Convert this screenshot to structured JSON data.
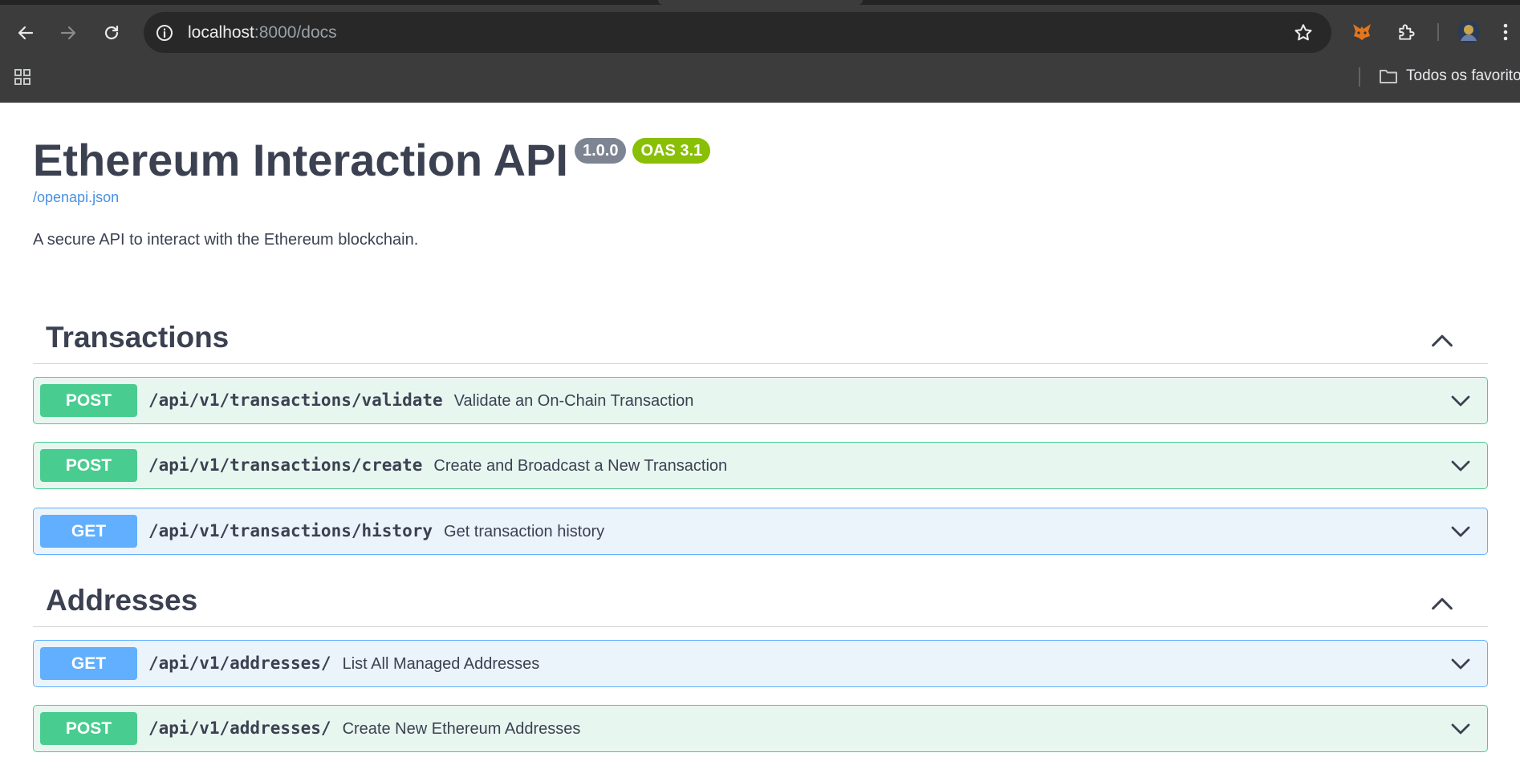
{
  "browser": {
    "url_host": "localhost",
    "url_path": ":8000/docs",
    "bookmarks_folder": "Todos os favoritos"
  },
  "api": {
    "title": "Ethereum Interaction API",
    "version": "1.0.0",
    "oas": "OAS 3.1",
    "spec_link": "/openapi.json",
    "description": "A secure API to interact with the Ethereum blockchain."
  },
  "sections": [
    {
      "name": "Transactions",
      "operations": [
        {
          "method": "POST",
          "path": "/api/v1/transactions/validate",
          "summary": "Validate an On-Chain Transaction"
        },
        {
          "method": "POST",
          "path": "/api/v1/transactions/create",
          "summary": "Create and Broadcast a New Transaction"
        },
        {
          "method": "GET",
          "path": "/api/v1/transactions/history",
          "summary": "Get transaction history"
        }
      ]
    },
    {
      "name": "Addresses",
      "operations": [
        {
          "method": "GET",
          "path": "/api/v1/addresses/",
          "summary": "List All Managed Addresses"
        },
        {
          "method": "POST",
          "path": "/api/v1/addresses/",
          "summary": "Create New Ethereum Addresses"
        }
      ]
    }
  ],
  "colors": {
    "post": "#49cc90",
    "get": "#61affe",
    "version_badge": "#7d8492",
    "oas_badge": "#89bf04",
    "link": "#4990e2",
    "text": "#3b4151"
  },
  "icons": [
    "back-icon",
    "forward-icon",
    "reload-icon",
    "info-icon",
    "star-icon",
    "metamask-icon",
    "extensions-icon",
    "profile-avatar",
    "more-icon",
    "apps-icon",
    "folder-icon",
    "chevron-up-icon",
    "chevron-down-icon"
  ]
}
